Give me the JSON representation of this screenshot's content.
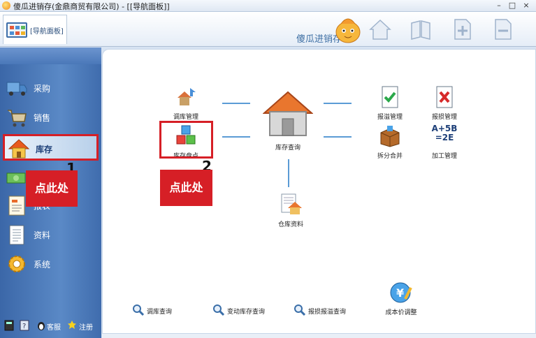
{
  "window": {
    "title": "傻瓜进销存(金鼎商贸有限公司) - [[导航面板]]",
    "min_btn": "–",
    "max_btn": "□",
    "close_btn": "×"
  },
  "toolbar": {
    "active_tab": "[导航面板]",
    "brand": "傻瓜进销存"
  },
  "sidebar": {
    "items": [
      {
        "label": "采购",
        "icon": "truck-icon"
      },
      {
        "label": "销售",
        "icon": "cart-icon"
      },
      {
        "label": "库存",
        "icon": "house-icon",
        "active": true
      },
      {
        "label": "财务",
        "icon": "money-icon"
      },
      {
        "label": "报表",
        "icon": "report-icon"
      },
      {
        "label": "资料",
        "icon": "document-icon"
      },
      {
        "label": "系统",
        "icon": "gear-icon"
      }
    ],
    "footer": {
      "service": "客服",
      "register": "注册"
    }
  },
  "main": {
    "nodes": {
      "transfer": "调库管理",
      "stocktake": "库存盘点",
      "inventory_query": "库存查询",
      "damage_report": "报溢管理",
      "loss_report": "报损管理",
      "split_merge": "拆分合并",
      "processing": "加工管理",
      "warehouse_data": "仓库资料",
      "cost_adjust": "成本价调整"
    },
    "processing_icon_text": {
      "line1": "A+5B",
      "line2": "=2E"
    },
    "queries": {
      "transfer_query": "调库查询",
      "movement_query": "变动库存查询",
      "damage_query": "报损报溢查询"
    }
  },
  "annotations": {
    "callout1_text": "点此处",
    "callout1_num": "1",
    "callout2_text": "点此处",
    "callout2_num": "2"
  },
  "colors": {
    "accent_red": "#d61f26",
    "sidebar_blue": "#4a78b9",
    "connector_blue": "#5b9bd5"
  }
}
